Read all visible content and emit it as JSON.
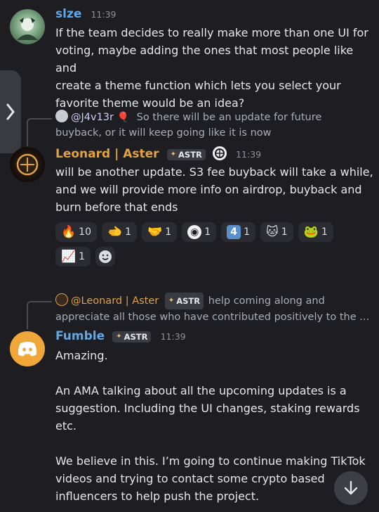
{
  "messages": [
    {
      "author": "slze",
      "time": "11:39",
      "lines": [
        "If the team decides to really make more than one UI for",
        "voting, maybe adding the ones that most people like and",
        "create a theme function which lets you select your",
        "favorite theme would be an idea?"
      ]
    },
    {
      "reply": {
        "author": "@J4v13r",
        "line1": "So there will be an update for future",
        "line2": "buyback, or it will keep going like it is now"
      },
      "author": "Leonard | Aster",
      "tag": "ASTR",
      "time": "11:39",
      "lines": [
        "will be another update. S3 fee buyback will take a while,",
        "and we will  provide more info on airdrop, buyback and",
        "burn before that ends"
      ],
      "reactions": [
        {
          "emoji": "🔥",
          "icon": "fire-emoji",
          "count": "10"
        },
        {
          "emoji": "🫲",
          "icon": "pepe-point-emoji",
          "count": "1"
        },
        {
          "emoji": "🤝",
          "icon": "handshake-emoji",
          "count": "1"
        },
        {
          "emoji": "◉",
          "icon": "aster-logo-emoji",
          "count": "1"
        },
        {
          "emoji": "4",
          "icon": "keycap-four-emoji",
          "count": "1"
        },
        {
          "emoji": "🐱",
          "icon": "cat-emoji",
          "count": "1"
        },
        {
          "emoji": "🐸",
          "icon": "pepe-emoji",
          "count": "1"
        },
        {
          "emoji": "📈",
          "icon": "stonks-emoji",
          "count": "1"
        }
      ]
    },
    {
      "reply": {
        "author": "@Leonard | Aster",
        "tag": "ASTR",
        "line1": "help coming along and",
        "line2": "appreciate all those who have contributed positively to the ..."
      },
      "author": "Fumble",
      "tag": "ASTR",
      "time": "11:39",
      "lines": [
        "Amazing.",
        "",
        "An AMA talking about all the upcoming updates is a",
        "suggestion. Including the UI changes, staking rewards",
        "etc.",
        "",
        "We believe in this. I’m going to continue making TikTok",
        "videos and trying to contact some crypto based",
        "influencers to help push the project."
      ]
    }
  ],
  "colors": {
    "background": "#1e1e22",
    "slze_name": "#5fa8e8",
    "leonard_name": "#e0a243",
    "fumble_name": "#5fa8e8",
    "reply_mention": "#c9cdfb"
  }
}
